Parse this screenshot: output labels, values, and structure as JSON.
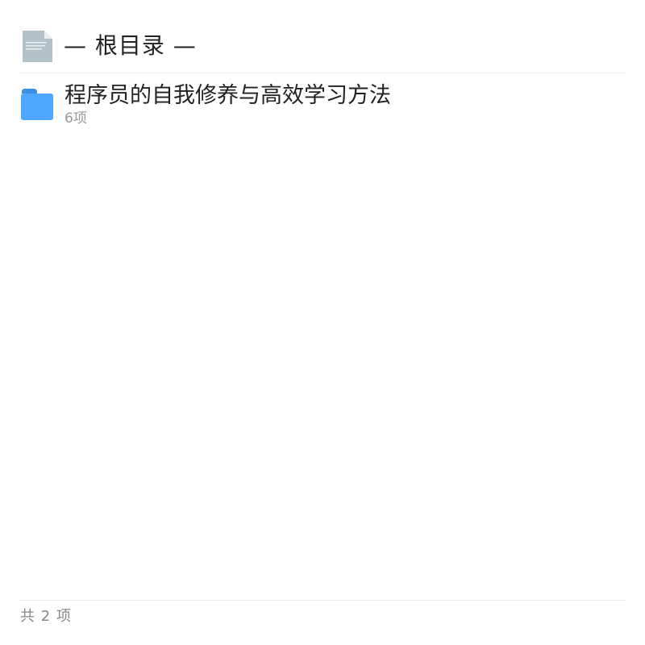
{
  "header": {
    "icon": "document-icon",
    "title": "— 根目录 —"
  },
  "list": {
    "items": [
      {
        "icon": "folder-icon",
        "name": "程序员的自我修养与高效学习方法",
        "meta": "6项"
      }
    ]
  },
  "footer": {
    "count_text": "共 2 项"
  },
  "colors": {
    "folder": "#4da6ff",
    "folder_tab": "#3d8fe6",
    "document": "#b3c1c9",
    "title_text": "#222222",
    "meta_text": "#999999",
    "divider": "#eeeeee"
  }
}
